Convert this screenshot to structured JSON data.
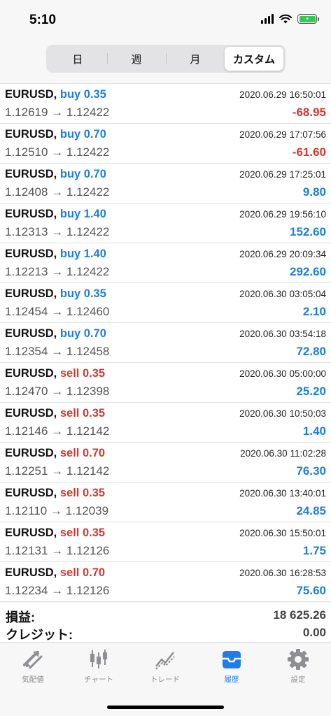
{
  "status": {
    "time": "5:10"
  },
  "segments": [
    {
      "label": "日",
      "active": false
    },
    {
      "label": "週",
      "active": false
    },
    {
      "label": "月",
      "active": false
    },
    {
      "label": "カスタム",
      "active": true
    }
  ],
  "trades": [
    {
      "symbol": "EURUSD,",
      "type": "buy",
      "volume": "0.35",
      "time": "2020.06.29 16:50:01",
      "prices": "1.12619 → 1.12422",
      "profit": "-68.95"
    },
    {
      "symbol": "EURUSD,",
      "type": "buy",
      "volume": "0.70",
      "time": "2020.06.29 17:07:56",
      "prices": "1.12510 → 1.12422",
      "profit": "-61.60"
    },
    {
      "symbol": "EURUSD,",
      "type": "buy",
      "volume": "0.70",
      "time": "2020.06.29 17:25:01",
      "prices": "1.12408 → 1.12422",
      "profit": "9.80"
    },
    {
      "symbol": "EURUSD,",
      "type": "buy",
      "volume": "1.40",
      "time": "2020.06.29 19:56:10",
      "prices": "1.12313 → 1.12422",
      "profit": "152.60"
    },
    {
      "symbol": "EURUSD,",
      "type": "buy",
      "volume": "1.40",
      "time": "2020.06.29 20:09:34",
      "prices": "1.12213 → 1.12422",
      "profit": "292.60"
    },
    {
      "symbol": "EURUSD,",
      "type": "buy",
      "volume": "0.35",
      "time": "2020.06.30 03:05:04",
      "prices": "1.12454 → 1.12460",
      "profit": "2.10"
    },
    {
      "symbol": "EURUSD,",
      "type": "buy",
      "volume": "0.70",
      "time": "2020.06.30 03:54:18",
      "prices": "1.12354 → 1.12458",
      "profit": "72.80"
    },
    {
      "symbol": "EURUSD,",
      "type": "sell",
      "volume": "0.35",
      "time": "2020.06.30 05:00:00",
      "prices": "1.12470 → 1.12398",
      "profit": "25.20"
    },
    {
      "symbol": "EURUSD,",
      "type": "sell",
      "volume": "0.35",
      "time": "2020.06.30 10:50:03",
      "prices": "1.12146 → 1.12142",
      "profit": "1.40"
    },
    {
      "symbol": "EURUSD,",
      "type": "sell",
      "volume": "0.70",
      "time": "2020.06.30 11:02:28",
      "prices": "1.12251 → 1.12142",
      "profit": "76.30"
    },
    {
      "symbol": "EURUSD,",
      "type": "sell",
      "volume": "0.35",
      "time": "2020.06.30 13:40:01",
      "prices": "1.12110 → 1.12039",
      "profit": "24.85"
    },
    {
      "symbol": "EURUSD,",
      "type": "sell",
      "volume": "0.35",
      "time": "2020.06.30 15:50:01",
      "prices": "1.12131 → 1.12126",
      "profit": "1.75"
    },
    {
      "symbol": "EURUSD,",
      "type": "sell",
      "volume": "0.70",
      "time": "2020.06.30 16:28:53",
      "prices": "1.12234 → 1.12126",
      "profit": "75.60"
    }
  ],
  "summary": {
    "profit_label": "損益:",
    "profit_value": "18 625.26",
    "credit_label": "クレジット:",
    "credit_value": "0.00"
  },
  "tabs": [
    {
      "label": "気配値",
      "icon": "quotes-arrows-icon",
      "active": false
    },
    {
      "label": "チャート",
      "icon": "candlestick-chart-icon",
      "active": false
    },
    {
      "label": "トレード",
      "icon": "trade-chart-icon",
      "active": false
    },
    {
      "label": "履歴",
      "icon": "history-inbox-icon",
      "active": true
    },
    {
      "label": "設定",
      "icon": "settings-gear-icon",
      "active": false
    }
  ],
  "colors": {
    "accent": "#1e7de6",
    "loss": "#d9362f",
    "battery": "#34c759",
    "tab_inactive": "#8e8e93"
  }
}
